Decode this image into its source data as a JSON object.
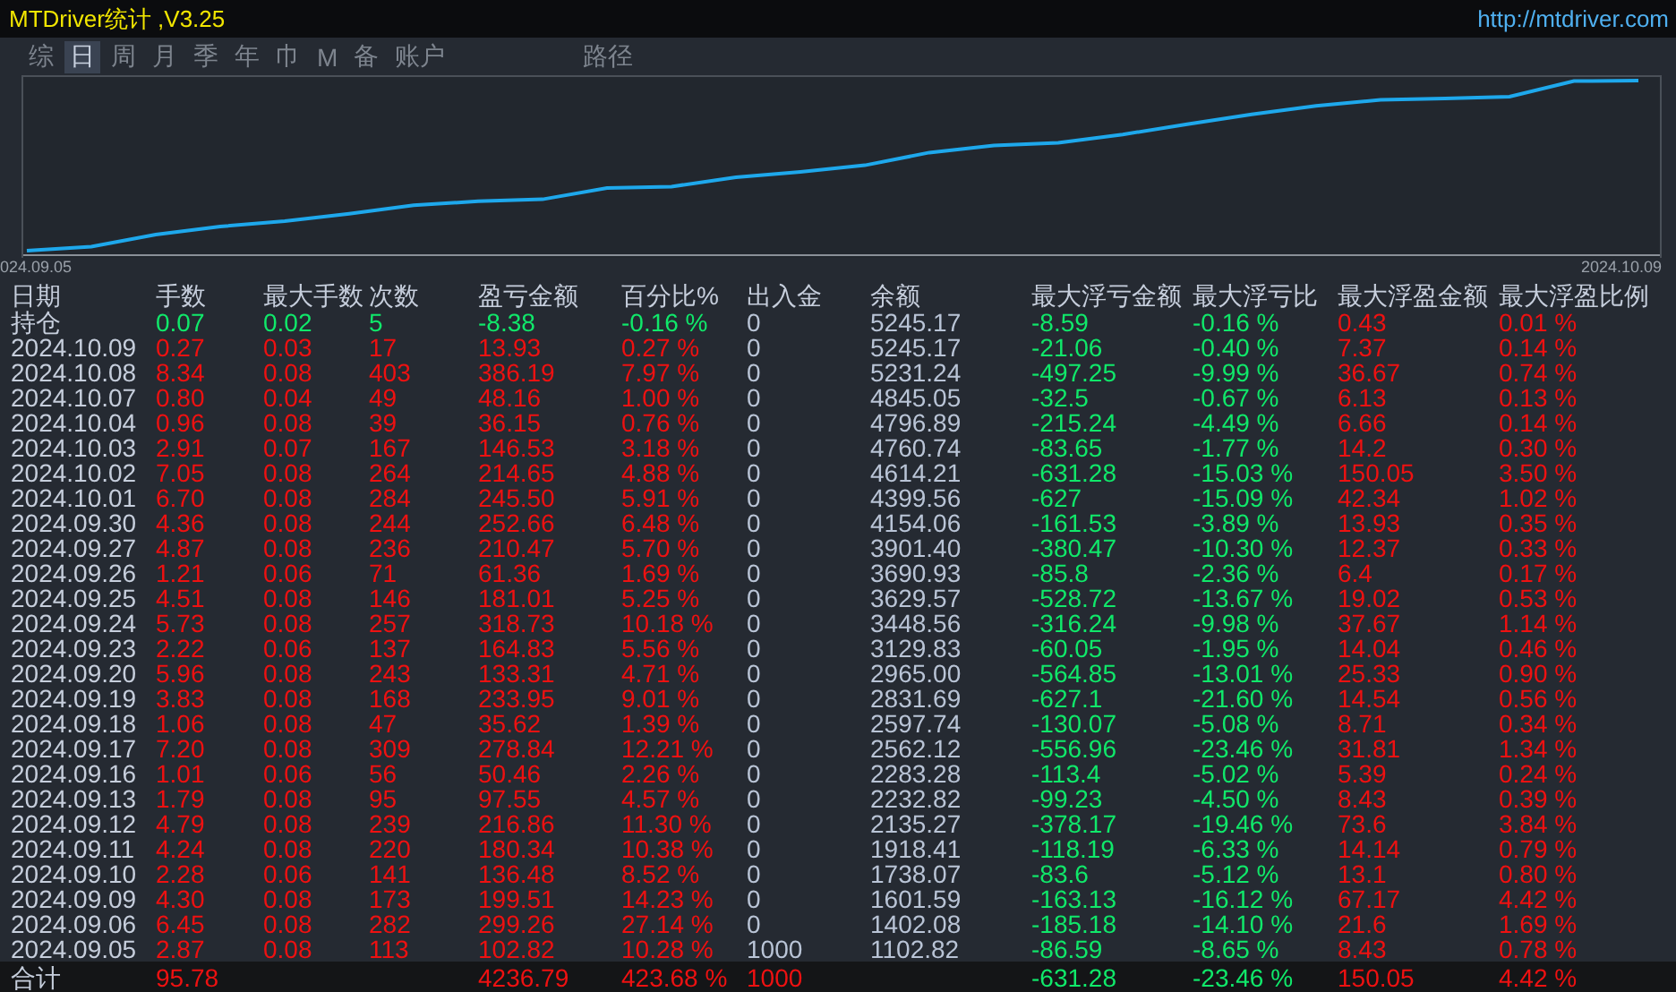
{
  "window": {
    "title": "MTDriver统计 ,V3.25",
    "link": "http://mtdriver.com"
  },
  "tabs": [
    {
      "label": "综",
      "selected": false
    },
    {
      "label": "日",
      "selected": true
    },
    {
      "label": "周",
      "selected": false
    },
    {
      "label": "月",
      "selected": false
    },
    {
      "label": "季",
      "selected": false
    },
    {
      "label": "年",
      "selected": false
    },
    {
      "label": "巾",
      "selected": false
    },
    {
      "label": "M",
      "selected": false
    },
    {
      "label": "备",
      "selected": false
    },
    {
      "label": "账户",
      "selected": false
    }
  ],
  "path_button": "路径",
  "chart": {
    "start_label": "024.09.05",
    "end_label": "2024.10.09"
  },
  "table": {
    "columns": [
      "日期",
      "手数",
      "最大手数",
      "次数",
      "盈亏金额",
      "百分比%",
      "出入金",
      "余额",
      "最大浮亏金额",
      "最大浮亏比",
      "最大浮盈金额",
      "最大浮盈比例"
    ],
    "rows": [
      {
        "kind": "position",
        "cells": [
          "持仓",
          "0.07",
          "0.02",
          "5",
          "-8.38",
          "-0.16 %",
          "0",
          "5245.17",
          "-8.59",
          "-0.16 %",
          "0.43",
          "0.01 %"
        ]
      },
      {
        "kind": "day",
        "cells": [
          "2024.10.09",
          "0.27",
          "0.03",
          "17",
          "13.93",
          "0.27 %",
          "0",
          "5245.17",
          "-21.06",
          "-0.40 %",
          "7.37",
          "0.14 %"
        ]
      },
      {
        "kind": "day",
        "cells": [
          "2024.10.08",
          "8.34",
          "0.08",
          "403",
          "386.19",
          "7.97 %",
          "0",
          "5231.24",
          "-497.25",
          "-9.99 %",
          "36.67",
          "0.74 %"
        ]
      },
      {
        "kind": "day",
        "cells": [
          "2024.10.07",
          "0.80",
          "0.04",
          "49",
          "48.16",
          "1.00 %",
          "0",
          "4845.05",
          "-32.5",
          "-0.67 %",
          "6.13",
          "0.13 %"
        ]
      },
      {
        "kind": "day",
        "cells": [
          "2024.10.04",
          "0.96",
          "0.08",
          "39",
          "36.15",
          "0.76 %",
          "0",
          "4796.89",
          "-215.24",
          "-4.49 %",
          "6.66",
          "0.14 %"
        ]
      },
      {
        "kind": "day",
        "cells": [
          "2024.10.03",
          "2.91",
          "0.07",
          "167",
          "146.53",
          "3.18 %",
          "0",
          "4760.74",
          "-83.65",
          "-1.77 %",
          "14.2",
          "0.30 %"
        ]
      },
      {
        "kind": "day",
        "cells": [
          "2024.10.02",
          "7.05",
          "0.08",
          "264",
          "214.65",
          "4.88 %",
          "0",
          "4614.21",
          "-631.28",
          "-15.03 %",
          "150.05",
          "3.50 %"
        ]
      },
      {
        "kind": "day",
        "cells": [
          "2024.10.01",
          "6.70",
          "0.08",
          "284",
          "245.50",
          "5.91 %",
          "0",
          "4399.56",
          "-627",
          "-15.09 %",
          "42.34",
          "1.02 %"
        ]
      },
      {
        "kind": "day",
        "cells": [
          "2024.09.30",
          "4.36",
          "0.08",
          "244",
          "252.66",
          "6.48 %",
          "0",
          "4154.06",
          "-161.53",
          "-3.89 %",
          "13.93",
          "0.35 %"
        ]
      },
      {
        "kind": "day",
        "cells": [
          "2024.09.27",
          "4.87",
          "0.08",
          "236",
          "210.47",
          "5.70 %",
          "0",
          "3901.40",
          "-380.47",
          "-10.30 %",
          "12.37",
          "0.33 %"
        ]
      },
      {
        "kind": "day",
        "cells": [
          "2024.09.26",
          "1.21",
          "0.06",
          "71",
          "61.36",
          "1.69 %",
          "0",
          "3690.93",
          "-85.8",
          "-2.36 %",
          "6.4",
          "0.17 %"
        ]
      },
      {
        "kind": "day",
        "cells": [
          "2024.09.25",
          "4.51",
          "0.08",
          "146",
          "181.01",
          "5.25 %",
          "0",
          "3629.57",
          "-528.72",
          "-13.67 %",
          "19.02",
          "0.53 %"
        ]
      },
      {
        "kind": "day",
        "cells": [
          "2024.09.24",
          "5.73",
          "0.08",
          "257",
          "318.73",
          "10.18 %",
          "0",
          "3448.56",
          "-316.24",
          "-9.98 %",
          "37.67",
          "1.14 %"
        ]
      },
      {
        "kind": "day",
        "cells": [
          "2024.09.23",
          "2.22",
          "0.06",
          "137",
          "164.83",
          "5.56 %",
          "0",
          "3129.83",
          "-60.05",
          "-1.95 %",
          "14.04",
          "0.46 %"
        ]
      },
      {
        "kind": "day",
        "cells": [
          "2024.09.20",
          "5.96",
          "0.08",
          "243",
          "133.31",
          "4.71 %",
          "0",
          "2965.00",
          "-564.85",
          "-13.01 %",
          "25.33",
          "0.90 %"
        ]
      },
      {
        "kind": "day",
        "cells": [
          "2024.09.19",
          "3.83",
          "0.08",
          "168",
          "233.95",
          "9.01 %",
          "0",
          "2831.69",
          "-627.1",
          "-21.60 %",
          "14.54",
          "0.56 %"
        ]
      },
      {
        "kind": "day",
        "cells": [
          "2024.09.18",
          "1.06",
          "0.08",
          "47",
          "35.62",
          "1.39 %",
          "0",
          "2597.74",
          "-130.07",
          "-5.08 %",
          "8.71",
          "0.34 %"
        ]
      },
      {
        "kind": "day",
        "cells": [
          "2024.09.17",
          "7.20",
          "0.08",
          "309",
          "278.84",
          "12.21 %",
          "0",
          "2562.12",
          "-556.96",
          "-23.46 %",
          "31.81",
          "1.34 %"
        ]
      },
      {
        "kind": "day",
        "cells": [
          "2024.09.16",
          "1.01",
          "0.06",
          "56",
          "50.46",
          "2.26 %",
          "0",
          "2283.28",
          "-113.4",
          "-5.02 %",
          "5.39",
          "0.24 %"
        ]
      },
      {
        "kind": "day",
        "cells": [
          "2024.09.13",
          "1.79",
          "0.08",
          "95",
          "97.55",
          "4.57 %",
          "0",
          "2232.82",
          "-99.23",
          "-4.50 %",
          "8.43",
          "0.39 %"
        ]
      },
      {
        "kind": "day",
        "cells": [
          "2024.09.12",
          "4.79",
          "0.08",
          "239",
          "216.86",
          "11.30 %",
          "0",
          "2135.27",
          "-378.17",
          "-19.46 %",
          "73.6",
          "3.84 %"
        ]
      },
      {
        "kind": "day",
        "cells": [
          "2024.09.11",
          "4.24",
          "0.08",
          "220",
          "180.34",
          "10.38 %",
          "0",
          "1918.41",
          "-118.19",
          "-6.33 %",
          "14.14",
          "0.79 %"
        ]
      },
      {
        "kind": "day",
        "cells": [
          "2024.09.10",
          "2.28",
          "0.06",
          "141",
          "136.48",
          "8.52 %",
          "0",
          "1738.07",
          "-83.6",
          "-5.12 %",
          "13.1",
          "0.80 %"
        ]
      },
      {
        "kind": "day",
        "cells": [
          "2024.09.09",
          "4.30",
          "0.08",
          "173",
          "199.51",
          "14.23 %",
          "0",
          "1601.59",
          "-163.13",
          "-16.12 %",
          "67.17",
          "4.42 %"
        ]
      },
      {
        "kind": "day",
        "cells": [
          "2024.09.06",
          "6.45",
          "0.08",
          "282",
          "299.26",
          "27.14 %",
          "0",
          "1402.08",
          "-185.18",
          "-14.10 %",
          "21.6",
          "1.69 %"
        ]
      },
      {
        "kind": "day",
        "cells": [
          "2024.09.05",
          "2.87",
          "0.08",
          "113",
          "102.82",
          "10.28 %",
          "1000",
          "1102.82",
          "-86.59",
          "-8.65 %",
          "8.43",
          "0.78 %"
        ]
      }
    ],
    "total": {
      "label": "合计",
      "lots": "95.78",
      "pnl": "4236.79",
      "pct": "423.68 %",
      "io": "1000",
      "max_float_loss": "-631.28",
      "max_float_loss_pct": "-23.46 %",
      "max_float_profit": "150.05",
      "max_float_profit_pct": "4.42 %"
    }
  }
}
